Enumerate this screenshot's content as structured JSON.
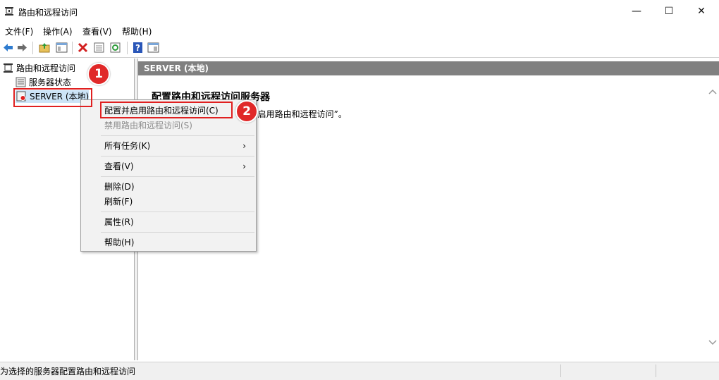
{
  "window": {
    "title": "路由和远程访问",
    "minimize": "—",
    "maximize": "☐",
    "close": "✕"
  },
  "menu": [
    "文件(F)",
    "操作(A)",
    "查看(V)",
    "帮助(H)"
  ],
  "toolbar_icons": [
    "back-arrow-icon",
    "forward-arrow-icon",
    "up-folder-icon",
    "show-hide-tree-icon",
    "delete-icon",
    "properties-icon",
    "refresh-icon",
    "help-icon",
    "console-pane-icon"
  ],
  "tree": {
    "root": "路由和远程访问",
    "server_status": "服务器状态",
    "server": "SERVER (本地)"
  },
  "main": {
    "header": "SERVER (本地)",
    "heading": "配置路由和远程访问服务器",
    "text": "在“操作”菜单上单击“配置并启用路由和远程访问”。"
  },
  "context_menu": {
    "items": [
      {
        "label": "配置并启用路由和远程访问(C)",
        "enabled": true
      },
      {
        "label": "禁用路由和远程访问(S)",
        "enabled": false
      },
      {
        "label": "所有任务(K)",
        "enabled": true,
        "submenu": "›"
      },
      {
        "label": "查看(V)",
        "enabled": true,
        "submenu": "›"
      },
      {
        "label": "删除(D)",
        "enabled": true
      },
      {
        "label": "刷新(F)",
        "enabled": true
      },
      {
        "label": "属性(R)",
        "enabled": true
      },
      {
        "label": "帮助(H)",
        "enabled": true
      }
    ]
  },
  "annotations": {
    "step1": "1",
    "step2": "2"
  },
  "status": {
    "text": "为选择的服务器配置路由和远程访问"
  },
  "colors": {
    "header_bg": "#808080",
    "highlight": "#e02020",
    "badge": "#e02828"
  }
}
